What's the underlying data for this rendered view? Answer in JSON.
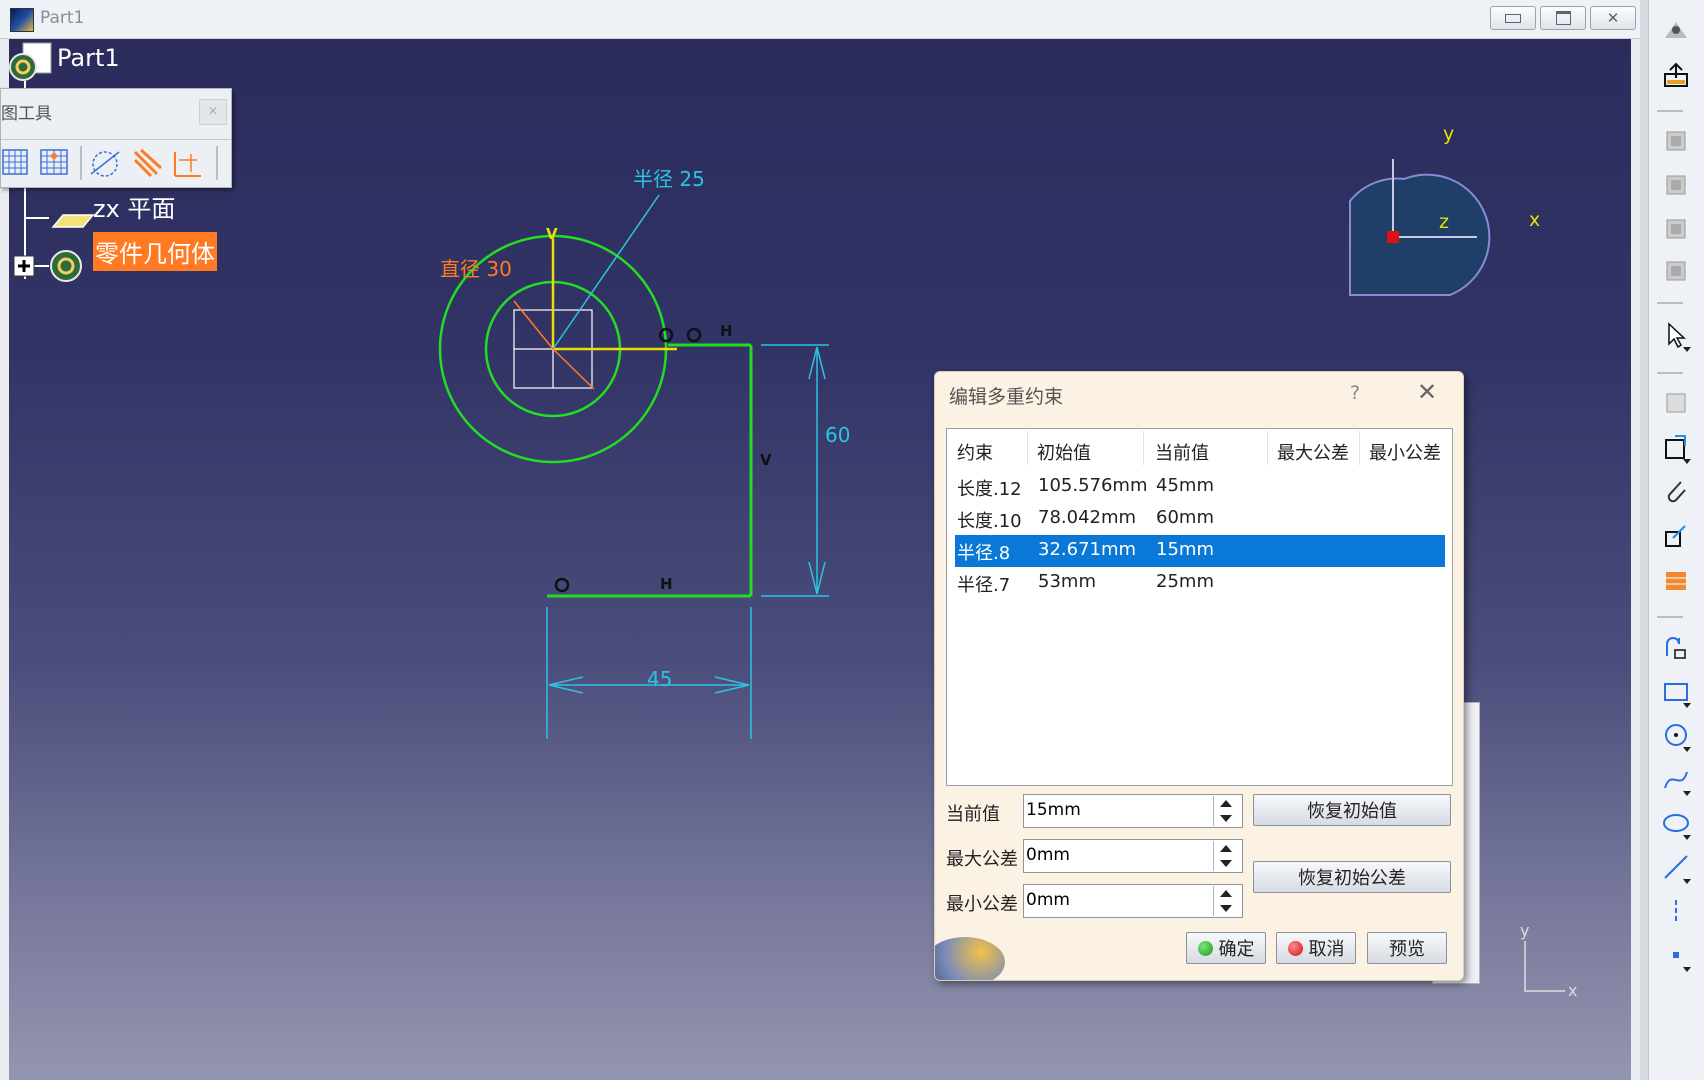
{
  "window": {
    "title": "Part1",
    "min_label": "▭",
    "max_label": "⧉",
    "close_label": "✕"
  },
  "tree": {
    "root": "Part1",
    "plane": "zx 平面",
    "body": "零件几何体"
  },
  "floating_toolbar": {
    "title": "图工具",
    "close": "×"
  },
  "sketch": {
    "radius_label": "半径 25",
    "diameter_label": "直径 30",
    "dim_vertical": "60",
    "dim_horizontal": "45",
    "constraint_h": "H",
    "constraint_v": "V"
  },
  "compass": {
    "x": "x",
    "y": "y",
    "z": "z"
  },
  "axis_corner": {
    "x": "x",
    "y": "y"
  },
  "dialog": {
    "title": "编辑多重约束",
    "help": "?",
    "close": "✕",
    "columns": [
      "约束",
      "初始值",
      "当前值",
      "最大公差",
      "最小公差"
    ],
    "rows": [
      {
        "name": "长度.12",
        "initial": "105.576mm",
        "current": "45mm",
        "selected": false
      },
      {
        "name": "长度.10",
        "initial": "78.042mm",
        "current": "60mm",
        "selected": false
      },
      {
        "name": "半径.8",
        "initial": "32.671mm",
        "current": "15mm",
        "selected": true
      },
      {
        "name": "半径.7",
        "initial": "53mm",
        "current": "25mm",
        "selected": false
      }
    ],
    "current_label": "当前值",
    "current_value": "15mm",
    "max_tol_label": "最大公差",
    "max_tol_value": "0mm",
    "min_tol_label": "最小公差",
    "min_tol_value": "0mm",
    "restore_initial": "恢复初始值",
    "restore_tolerance": "恢复初始公差",
    "ok": "确定",
    "cancel": "取消",
    "preview": "预览"
  }
}
